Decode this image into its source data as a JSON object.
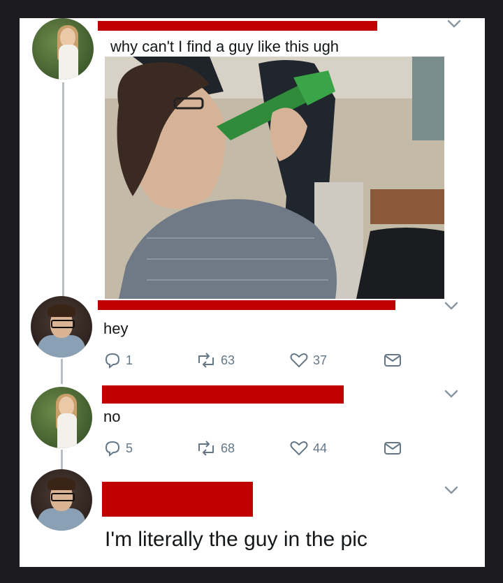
{
  "tweets": [
    {
      "text": "why can't I find a guy like this ugh"
    },
    {
      "text": "hey",
      "replies": "1",
      "retweets": "63",
      "likes": "37"
    },
    {
      "text": "no",
      "replies": "5",
      "retweets": "68",
      "likes": "44"
    },
    {
      "text": "I'm literally the guy in the pic"
    }
  ],
  "icons": {
    "reply": "reply-icon",
    "retweet": "retweet-icon",
    "like": "heart-icon",
    "message": "envelope-icon",
    "chevron": "chevron-down-icon"
  },
  "colors": {
    "redaction": "#c00000",
    "action_gray": "#657786"
  }
}
